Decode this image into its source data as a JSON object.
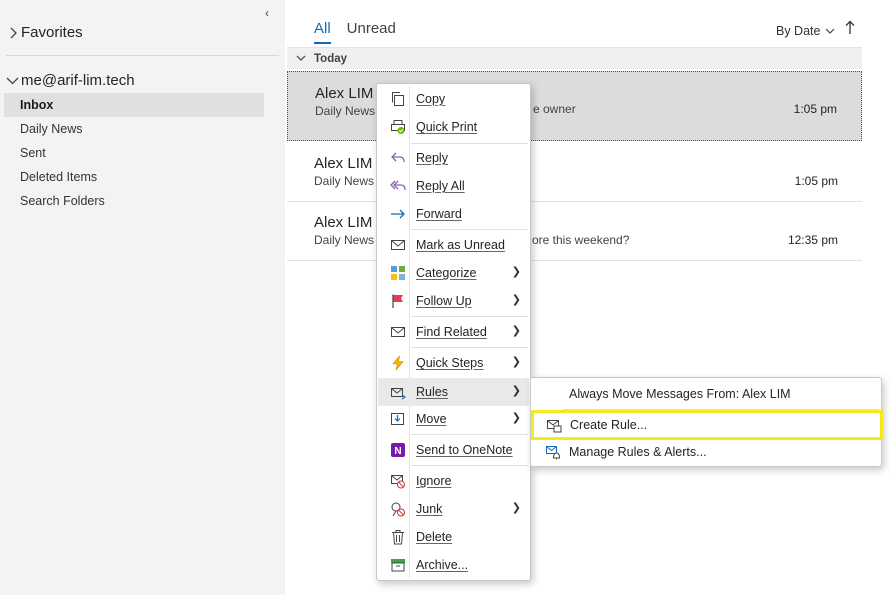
{
  "sidebar": {
    "collapse_glyph": "‹",
    "favorites": "Favorites",
    "account": "me@arif-lim.tech",
    "folders": [
      "Inbox",
      "Daily News",
      "Sent",
      "Deleted Items",
      "Search Folders"
    ]
  },
  "list": {
    "tabs": [
      "All",
      "Unread"
    ],
    "sort_label": "By Date",
    "group_label": "Today",
    "messages": [
      {
        "sender": "Alex LIM",
        "sub_a": "Daily News",
        "sub_b": "e owner",
        "time": "1:05 pm"
      },
      {
        "sender": "Alex LIM",
        "sub_a": "Daily News",
        "sub_b": "",
        "time": "1:05 pm"
      },
      {
        "sender": "Alex LIM",
        "sub_a": "Daily News",
        "sub_b": "ore this weekend?",
        "time": "12:35 pm"
      }
    ]
  },
  "context_menu": {
    "items": [
      {
        "label": "Copy",
        "icon": "copy-icon"
      },
      {
        "label": "Quick Print",
        "icon": "quick-print-icon"
      },
      {
        "label": "Reply",
        "icon": "reply-icon"
      },
      {
        "label": "Reply All",
        "icon": "reply-all-icon"
      },
      {
        "label": "Forward",
        "icon": "forward-icon"
      },
      {
        "label": "Mark as Unread",
        "icon": "mail-icon"
      },
      {
        "label": "Categorize",
        "icon": "categorize-icon"
      },
      {
        "label": "Follow Up",
        "icon": "flag-icon"
      },
      {
        "label": "Find Related",
        "icon": "find-related-icon"
      },
      {
        "label": "Quick Steps",
        "icon": "lightning-icon"
      },
      {
        "label": "Rules",
        "icon": "rules-icon"
      },
      {
        "label": "Move",
        "icon": "move-icon"
      },
      {
        "label": "Send to OneNote",
        "icon": "onenote-icon"
      },
      {
        "label": "Ignore",
        "icon": "ignore-icon"
      },
      {
        "label": "Junk",
        "icon": "junk-icon"
      },
      {
        "label": "Delete",
        "icon": "trash-icon"
      },
      {
        "label": "Archive...",
        "icon": "archive-icon"
      }
    ]
  },
  "rules_submenu": {
    "items": [
      {
        "label": "Always Move Messages From: Alex LIM"
      },
      {
        "label": "Create Rule...",
        "icon": "create-rule-icon"
      },
      {
        "label": "Manage Rules & Alerts...",
        "icon": "manage-rules-icon"
      }
    ]
  },
  "colors": {
    "accent": "#0f6cbd",
    "focus_highlight": "#f4ea1b"
  }
}
